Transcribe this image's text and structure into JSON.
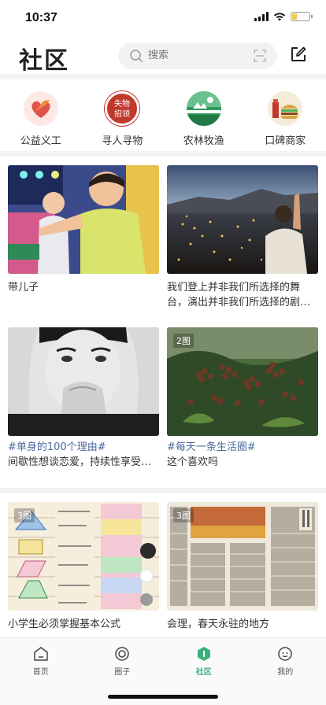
{
  "status": {
    "time": "10:37",
    "battery_level": 0.3
  },
  "header": {
    "title": "社区",
    "search_placeholder": "搜索"
  },
  "categories": [
    {
      "label": "公益义工",
      "icon": "heart-hands-icon",
      "color": "#e0524b"
    },
    {
      "label": "寻人寻物",
      "icon": "lost-found-icon",
      "color": "#c0392b",
      "text": "失物\n招领"
    },
    {
      "label": "农林牧渔",
      "icon": "farm-icon",
      "color": "#2e9b5c"
    },
    {
      "label": "口碑商家",
      "icon": "shop-icon",
      "color": "#d9a441"
    }
  ],
  "feed": [
    {
      "text": "带儿子",
      "topic": "",
      "badge": ""
    },
    {
      "text": "我们登上并非我们所选择的舞台，演出并非我们所选择的剧…",
      "topic": "",
      "badge": ""
    },
    {
      "text": "间歇性想谈恋爱，持续性享受…",
      "topic": "#单身的100个理由#",
      "badge": ""
    },
    {
      "text": "这个喜欢吗",
      "topic": "#每天一条生活圈#",
      "badge": "2图"
    },
    {
      "text": "小学生必须掌握基本公式",
      "topic": "",
      "badge": "3图"
    },
    {
      "text": "会理，春天永驻的地方",
      "topic": "",
      "badge": "3图"
    }
  ],
  "tabs": [
    {
      "label": "首页",
      "icon": "home-icon",
      "active": false
    },
    {
      "label": "圈子",
      "icon": "circle-icon",
      "active": false
    },
    {
      "label": "社区",
      "icon": "community-icon",
      "active": true
    },
    {
      "label": "我的",
      "icon": "profile-icon",
      "active": false
    }
  ],
  "colors": {
    "accent": "#3bb07a",
    "topic": "#4a6a9c"
  }
}
